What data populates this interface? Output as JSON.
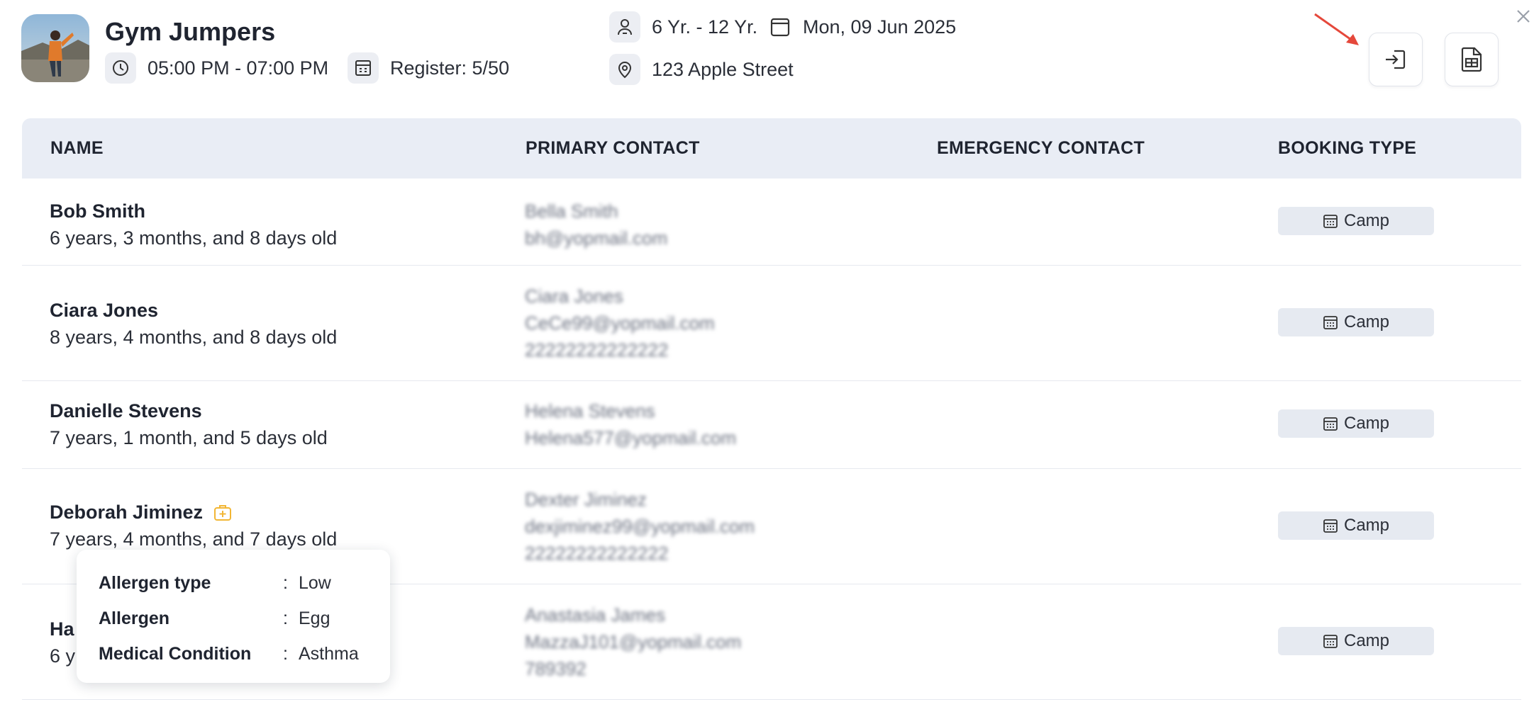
{
  "header": {
    "title": "Gym Jumpers",
    "time": "05:00 PM - 07:00 PM",
    "register": "Register: 5/50",
    "age_range": "6 Yr. - 12 Yr.",
    "date": "Mon, 09 Jun 2025",
    "address": "123 Apple Street"
  },
  "icons": {
    "time": "clock-icon",
    "register": "register-icon",
    "age": "person-icon",
    "date": "calendar-icon",
    "address": "location-icon",
    "close": "close-icon",
    "check_in": "sign-in-icon",
    "export": "spreadsheet-icon",
    "allergy": "medical-bag-icon",
    "booking": "calendar-grid-icon"
  },
  "table": {
    "columns": [
      "NAME",
      "PRIMARY CONTACT",
      "EMERGENCY CONTACT",
      "BOOKING TYPE"
    ],
    "rows": [
      {
        "name": "Bob Smith",
        "age": "6 years, 3 months, and 8 days old",
        "contact_lines": [
          "Bella Smith",
          "bh@yopmail.com"
        ],
        "emergency": "",
        "booking": "Camp"
      },
      {
        "name": "Ciara Jones",
        "age": "8 years, 4 months, and 8 days old",
        "contact_lines": [
          "Ciara Jones",
          "CeCe99@yopmail.com",
          "22222222222222"
        ],
        "emergency": "",
        "booking": "Camp"
      },
      {
        "name": "Danielle Stevens",
        "age": "7 years, 1 month, and 5 days old",
        "contact_lines": [
          "Helena Stevens",
          "Helena577@yopmail.com"
        ],
        "emergency": "",
        "booking": "Camp"
      },
      {
        "name": "Deborah Jiminez",
        "age": "7 years, 4 months, and 7 days old",
        "contact_lines": [
          "Dexter Jiminez",
          "dexjiminez99@yopmail.com",
          "22222222222222"
        ],
        "emergency": "",
        "booking": "Camp"
      },
      {
        "name": "Ha",
        "age": "6 y",
        "contact_lines": [
          "Anastasia James",
          "MazzaJ101@yopmail.com",
          "789392"
        ],
        "emergency": "",
        "booking": "Camp"
      }
    ]
  },
  "tooltip": {
    "rows": [
      {
        "label": "Allergen type",
        "value": "Low"
      },
      {
        "label": "Allergen",
        "value": "Egg"
      },
      {
        "label": "Medical Condition",
        "value": "Asthma"
      }
    ]
  },
  "colors": {
    "accent_arrow": "#e5483b",
    "allergy_icon": "#f2b635",
    "header_bg": "#e9edf5",
    "badge_bg": "#e6eaf1"
  }
}
